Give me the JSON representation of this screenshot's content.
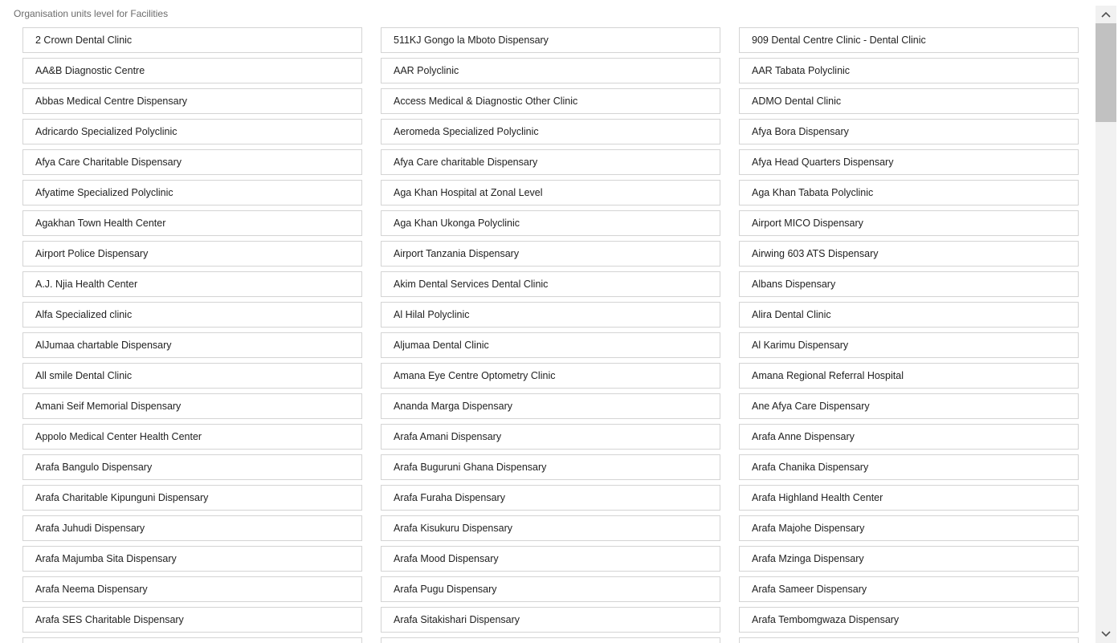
{
  "header": {
    "title": "Organisation units level for Facilities"
  },
  "facilities": [
    "2 Crown Dental Clinic",
    "511KJ Gongo la Mboto Dispensary",
    "909 Dental Centre Clinic - Dental Clinic",
    "AA&B Diagnostic Centre",
    "AAR Polyclinic",
    "AAR Tabata Polyclinic",
    "Abbas Medical Centre Dispensary",
    "Access Medical & Diagnostic Other Clinic",
    "ADMO Dental Clinic",
    "Adricardo Specialized Polyclinic",
    "Aeromeda Specialized Polyclinic",
    "Afya Bora Dispensary",
    "Afya Care Charitable Dispensary",
    "Afya Care charitable Dispensary",
    "Afya Head Quarters Dispensary",
    "Afyatime Specialized Polyclinic",
    "Aga Khan Hospital at Zonal Level",
    "Aga Khan Tabata Polyclinic",
    "Agakhan Town Health Center",
    "Aga Khan Ukonga Polyclinic",
    "Airport MICO Dispensary",
    "Airport Police Dispensary",
    "Airport Tanzania Dispensary",
    "Airwing 603 ATS Dispensary",
    "A.J. Njia Health Center",
    "Akim Dental Services Dental Clinic",
    "Albans Dispensary",
    "Alfa Specialized clinic",
    "Al Hilal Polyclinic",
    "Alira Dental Clinic",
    "AlJumaa chartable Dispensary",
    "Aljumaa Dental Clinic",
    "Al Karimu Dispensary",
    "All smile Dental Clinic",
    "Amana Eye Centre Optometry Clinic",
    "Amana Regional Referral Hospital",
    "Amani Seif Memorial Dispensary",
    "Ananda Marga Dispensary",
    "Ane Afya Care Dispensary",
    "Appolo Medical Center Health Center",
    "Arafa Amani Dispensary",
    "Arafa Anne Dispensary",
    "Arafa Bangulo Dispensary",
    "Arafa Buguruni Ghana Dispensary",
    "Arafa Chanika Dispensary",
    "Arafa Charitable Kipunguni Dispensary",
    "Arafa Furaha Dispensary",
    "Arafa Highland Health Center",
    "Arafa Juhudi Dispensary",
    "Arafa Kisukuru Dispensary",
    "Arafa Majohe Dispensary",
    "Arafa Majumba Sita Dispensary",
    "Arafa Mood Dispensary",
    "Arafa Mzinga Dispensary",
    "Arafa Neema Dispensary",
    "Arafa Pugu Dispensary",
    "Arafa Sameer Dispensary",
    "Arafa SES Charitable Dispensary",
    "Arafa Sitakishari Dispensary",
    "Arafa Tembomgwaza Dispensary",
    "",
    "",
    ""
  ],
  "scrollbar": {
    "up_icon": "chevron-up-icon",
    "down_icon": "chevron-down-icon",
    "thumb_color": "#c1c1c1",
    "track_color": "#f1f1f1"
  }
}
